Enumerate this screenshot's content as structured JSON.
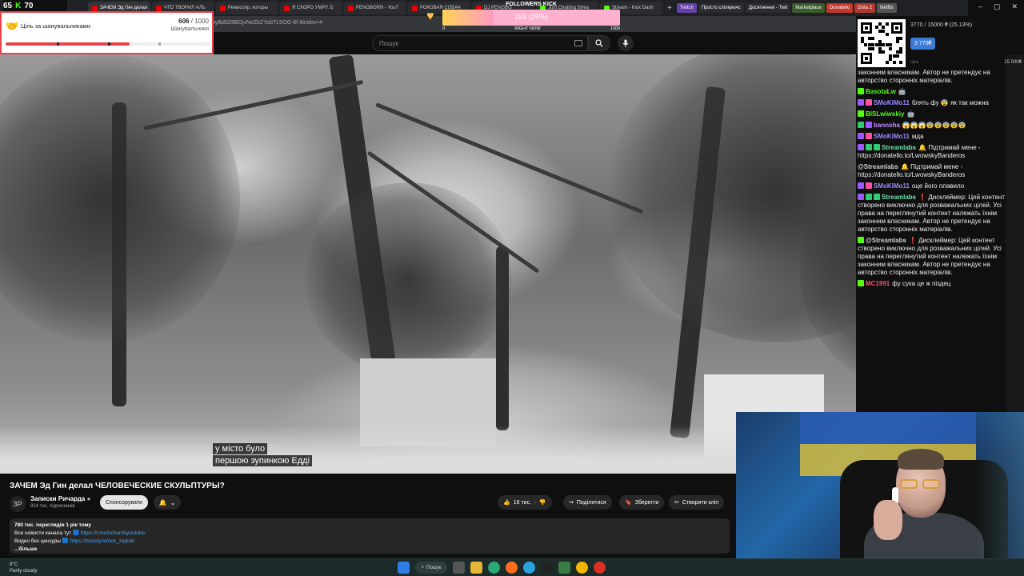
{
  "browser": {
    "tabs": [
      {
        "label": "ЗАЧЕМ Эд Гин делал",
        "type": "youtube",
        "active": true
      },
      {
        "label": "ЧТО ТВОРИЛ АЛЬ",
        "type": "youtube"
      },
      {
        "label": "Режиссёр, которы",
        "type": "youtube"
      },
      {
        "label": "Я СКОРО УМРУ. Б",
        "type": "youtube"
      },
      {
        "label": "PENGBORN - YouT",
        "type": "youtube"
      },
      {
        "label": "РОКОВАЯ СОБАЧ",
        "type": "youtube"
      },
      {
        "label": "DJ PENGBO",
        "type": "youtube"
      },
      {
        "label": "Just Chatting Strea",
        "type": "kick"
      },
      {
        "label": "Stream - Kick Dash",
        "type": "kick"
      }
    ],
    "bookmarks": [
      {
        "label": "Twitch",
        "color": "#6441a5"
      },
      {
        "label": "Просто спілкуючс",
        "color": "#2b2c30"
      },
      {
        "label": "Досягнення - Twit",
        "color": "#2b2c30"
      },
      {
        "label": "Marketplace",
        "color": "#3b5b2b"
      },
      {
        "label": "Donatello",
        "color": "#c0392b"
      },
      {
        "label": "Dota 2",
        "color": "#b03a2e"
      },
      {
        "label": "Netflix",
        "color": "#555"
      }
    ],
    "address": "pyBd9Z8BDjvNeZbZYobTL5GG-8f-8index=4"
  },
  "youtube": {
    "search_placeholder": "Пошук",
    "video": {
      "caption_line1": "у місто було",
      "caption_line2": "першою зупинкою Едді",
      "title": "ЗАЧЕМ Эд Гин делал ЧЕЛОВЕЧЕСКИЕ СКУЛЬПТУРЫ?"
    },
    "channel": {
      "avatar": "ЗР",
      "name": "Записки Ричарда",
      "subs": "914 тис. підписників",
      "sponsor_label": "Спонсорувати"
    },
    "actions": {
      "like_count": "16 тис.",
      "share": "Поділитися",
      "save": "Зберегти",
      "clip": "Створити кліп"
    },
    "description": {
      "stats": "780 тис. переглядів  1 рік тому",
      "line1_text": "Все новости канала тут",
      "line1_link": "https://t.me/richardsyoutube",
      "line2_text": "Видео без цензуры",
      "line2_link": "https://boosty.to/rick_zapiski",
      "more": "...більше"
    }
  },
  "overlays": {
    "streak": {
      "left": "65",
      "right": "70"
    },
    "goal": {
      "title": "Ціль за шанувальниками",
      "current": "606",
      "target": "/ 1000",
      "subtitle": "Шанувальники",
      "progress": 0.606
    },
    "followers": {
      "title": "FOLLOWERS KICK",
      "value": "293 (29%)",
      "progress": 0.29,
      "min": "0",
      "label": "RIGHT NOW",
      "max": "1000"
    },
    "donation": {
      "progress_text": "3770 / 15000 ₴ (25.13%)",
      "current": "3 770₴",
      "min_label": "Ціль",
      "max": "15 000₴"
    }
  },
  "chat": [
    {
      "user": "",
      "color": "#cfcfcf",
      "badges": [],
      "text": "законним власникам. Автор не претендує на авторство сторонніх матеріалів."
    },
    {
      "user": "BasotaLw",
      "color": "#53fc18",
      "badges": [
        "kick"
      ],
      "text": "🤖"
    },
    {
      "user": "SMoKiMo11",
      "color": "#9b8cff",
      "badges": [
        "purple",
        "pink"
      ],
      "text": "блять фу 😨 як так можна"
    },
    {
      "user": "BISLwiwskiy",
      "color": "#53fc18",
      "badges": [
        "kick"
      ],
      "text": "🤖"
    },
    {
      "user": "bannsha",
      "color": "#c58cff",
      "badges": [
        "green",
        "purple"
      ],
      "text": "😱😱😱😨😨😨😨😨"
    },
    {
      "user": "SMoKiMo11",
      "color": "#9b8cff",
      "badges": [
        "purple",
        "pink"
      ],
      "text": "мда"
    },
    {
      "user": "Streamlabs",
      "color": "#6be3b0",
      "badges": [
        "purple",
        "green",
        "green"
      ],
      "text": "🔔 Підтримай мене - https://donatello.to/LwowskyBanderos"
    },
    {
      "user": "@Streamlabs",
      "color": "#cfcfcf",
      "badges": [],
      "text": "🔔 Підтримай мене - https://donatello.to/LwowskyBanderos"
    },
    {
      "user": "SMoKiMo11",
      "color": "#9b8cff",
      "badges": [
        "purple",
        "pink"
      ],
      "text": "оце його плавило"
    },
    {
      "user": "Streamlabs",
      "color": "#6be3b0",
      "badges": [
        "purple",
        "green",
        "green"
      ],
      "text": "❗ Дисклеймер: Цей контент створено виключно для розважальних цілей. Усі права на переглянутий контент належать їхнім законним власникам. Автор не претендує на авторство сторонніх матеріалів."
    },
    {
      "user": "@Streamlabs",
      "color": "#cfcfcf",
      "badges": [
        "kick"
      ],
      "text": "❗ Дисклеймер: Цей контент створено виключно для розважальних цілей. Усі права на переглянутий контент належать їхнім законним власникам. Автор не претендує на авторство сторонніх матеріалів."
    },
    {
      "user": "MC1991",
      "color": "#ff4f6d",
      "badges": [
        "kick"
      ],
      "text": "фу сука це ж піздец"
    }
  ],
  "taskbar": {
    "temp": "8°C",
    "weather": "Partly cloudy",
    "search": "Пошук"
  }
}
